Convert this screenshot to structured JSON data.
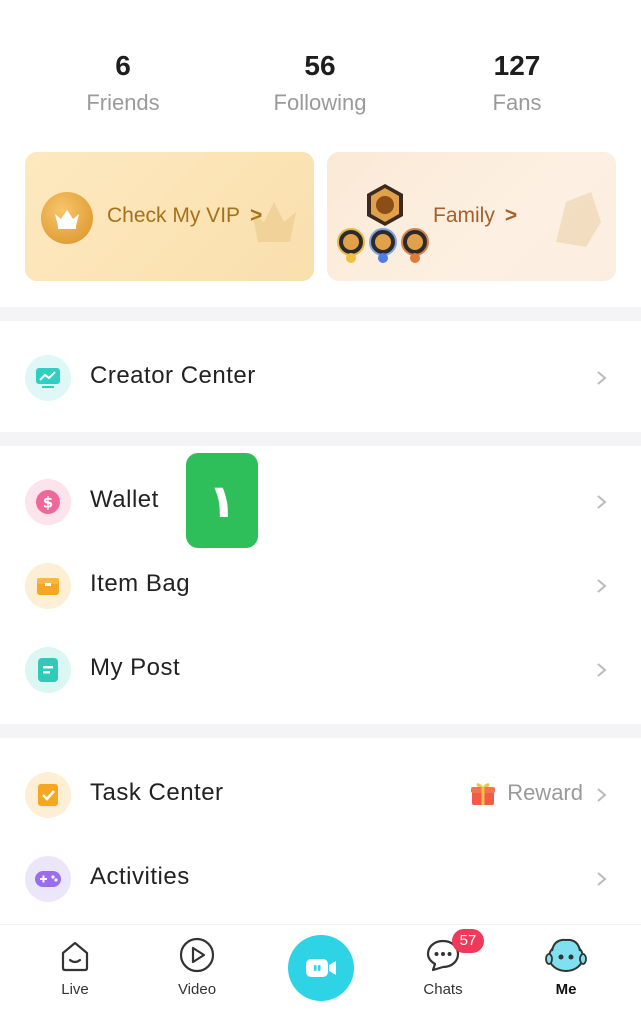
{
  "stats": {
    "friends": {
      "count": "6",
      "label": "Friends"
    },
    "following": {
      "count": "56",
      "label": "Following"
    },
    "fans": {
      "count": "127",
      "label": "Fans"
    }
  },
  "cards": {
    "vip": {
      "label": "Check My VIP",
      "chevron": ">",
      "icon": "crown-icon"
    },
    "family": {
      "label": "Family",
      "chevron": ">",
      "icon": "lion-badge-icon",
      "ranks": [
        "1",
        "2",
        "3"
      ]
    }
  },
  "menu": {
    "creator_center": {
      "label": "Creator Center",
      "icon": "chart-screen-icon"
    },
    "wallet": {
      "label": "Wallet",
      "icon": "dollar-coin-icon"
    },
    "item_bag": {
      "label": "Item Bag",
      "icon": "box-icon"
    },
    "my_post": {
      "label": "My Post",
      "icon": "post-note-icon"
    },
    "task_center": {
      "label": "Task Center",
      "icon": "task-check-icon",
      "extra": "Reward",
      "extra_icon": "gift-icon"
    },
    "activities": {
      "label": "Activities",
      "icon": "gamepad-icon"
    }
  },
  "annotation": {
    "text": "١"
  },
  "bottom_nav": {
    "live": {
      "label": "Live",
      "icon": "live-house-icon"
    },
    "video": {
      "label": "Video",
      "icon": "play-circle-icon"
    },
    "record": {
      "icon": "video-camera-icon"
    },
    "chats": {
      "label": "Chats",
      "icon": "chat-bubble-icon",
      "badge": "57"
    },
    "me": {
      "label": "Me",
      "icon": "mascot-icon"
    }
  },
  "colors": {
    "accent_cyan": "#2ed3e6",
    "vip_gold": "#a6711b",
    "badge_red": "#f0395a",
    "annotation_green": "#2fbf5a"
  }
}
